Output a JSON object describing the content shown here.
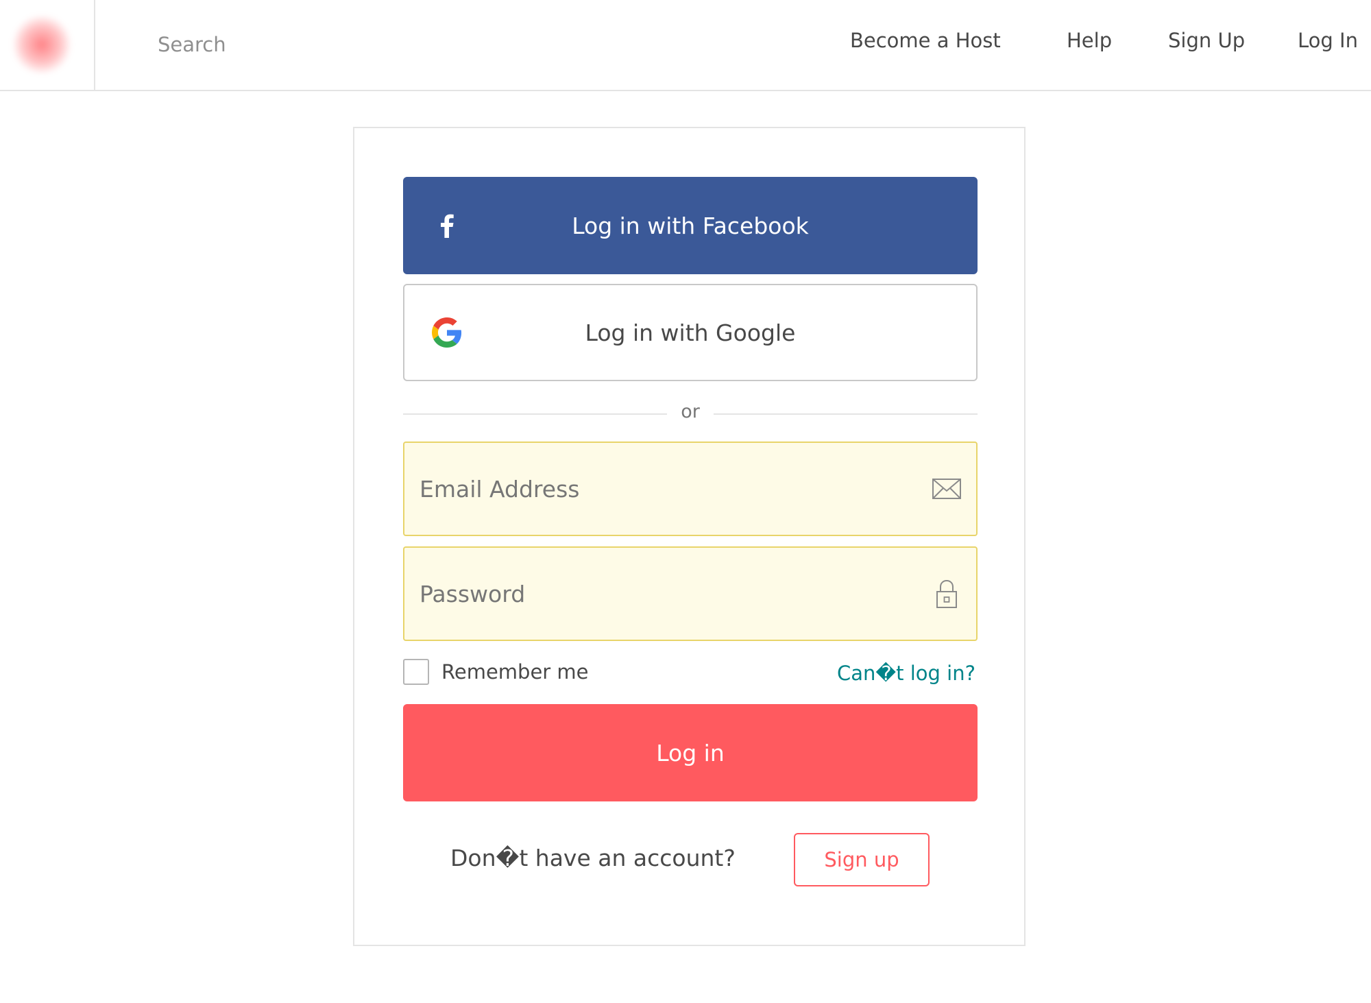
{
  "header": {
    "search_placeholder": "Search",
    "nav": {
      "become_host": "Become a Host",
      "help": "Help",
      "sign_up": "Sign Up",
      "log_in": "Log In"
    }
  },
  "login": {
    "facebook_label": "Log in with Facebook",
    "google_label": "Log in with Google",
    "divider_text": "or",
    "email_placeholder": "Email Address",
    "password_placeholder": "Password",
    "remember_label": "Remember me",
    "forgot_link": "Can�t log in?",
    "submit_label": "Log in",
    "no_account_text": "Don�t have an account?",
    "signup_button": "Sign up"
  },
  "icons": {
    "logo": "brand-logo-icon",
    "facebook": "facebook-icon",
    "google": "google-icon",
    "email": "envelope-icon",
    "password": "lock-icon"
  },
  "colors": {
    "brand": "#ff5a5f",
    "facebook": "#3b5998",
    "link": "#008489",
    "field_bg": "#fefbe7",
    "field_border": "#e8d46a"
  }
}
